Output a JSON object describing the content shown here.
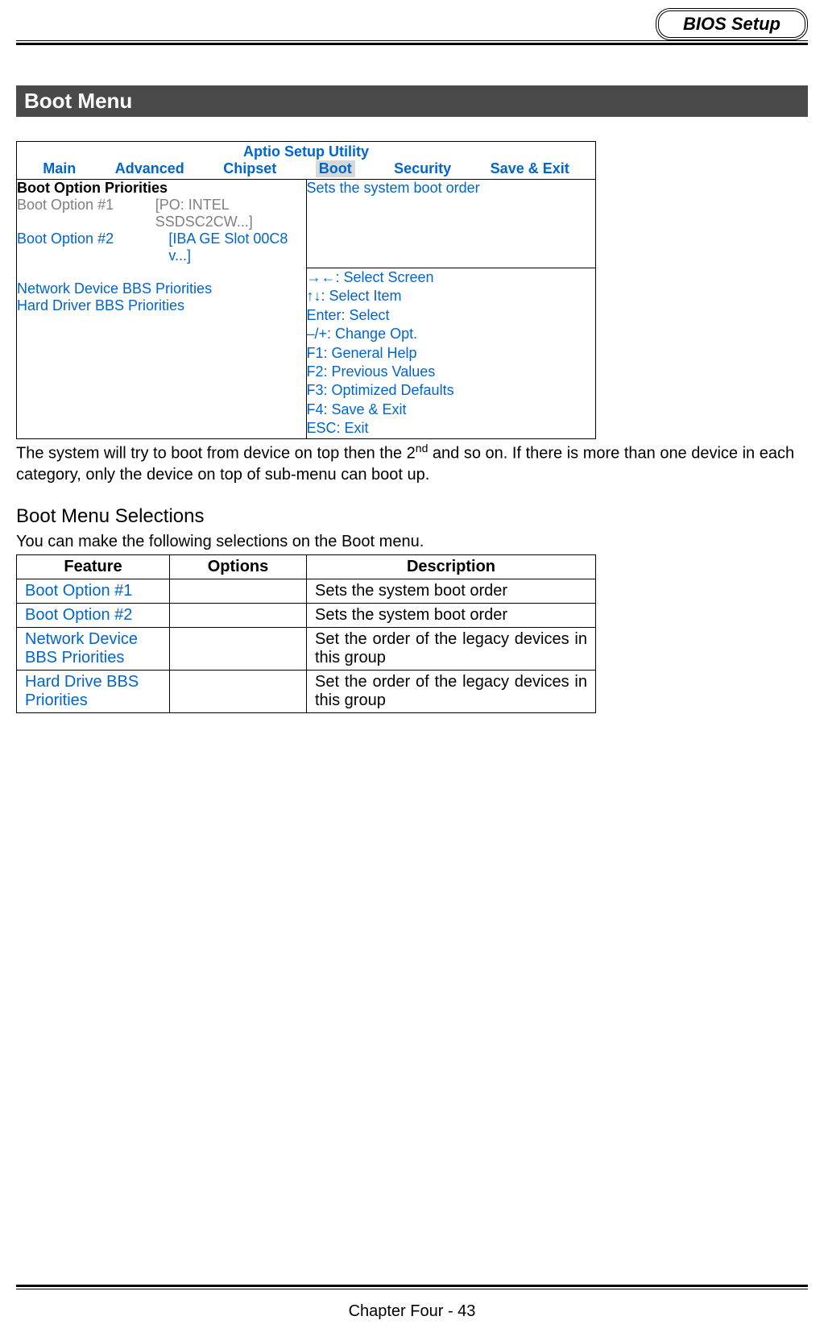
{
  "header": {
    "badge": "BIOS Setup"
  },
  "section_title": "Boot Menu",
  "bios": {
    "utility_title": "Aptio Setup Utility",
    "tabs": {
      "main": "Main",
      "advanced": "Advanced",
      "chipset": "Chipset",
      "boot": "Boot",
      "security": "Security",
      "save_exit": "Save & Exit"
    },
    "main_panel": {
      "priorities_heading": "Boot Option Priorities",
      "option1_label": "Boot Option #1",
      "option1_value": "[PO: INTEL SSDSC2CW...]",
      "option2_label": "Boot Option #2",
      "option2_value": "[IBA GE Slot 00C8 v...]",
      "network_bbs": "Network Device BBS Priorities",
      "hard_bbs": "Hard Driver BBS Priorities"
    },
    "right_panel": {
      "description": "Sets the system boot order",
      "help": {
        "select_screen": "→←: Select Screen",
        "select_item": "↑↓: Select Item",
        "enter": "Enter: Select",
        "change_opt": "–/+: Change Opt.",
        "f1": "F1: General Help",
        "f2": "F2: Previous Values",
        "f3": "F3: Optimized Defaults",
        "f4": "F4: Save & Exit",
        "esc": "ESC: Exit"
      }
    }
  },
  "paragraphs": {
    "boot_note_pre": "The system will try to boot from device on top then the 2",
    "boot_note_sup": "nd",
    "boot_note_post": " and so on. If there is more than one device in each category, only the device on top of sub-menu can boot up.",
    "selections_heading": "Boot Menu Selections",
    "selections_intro": "You can make the following selections on the Boot menu."
  },
  "selections_table": {
    "headers": {
      "feature": "Feature",
      "options": "Options",
      "description": "Description"
    },
    "rows": [
      {
        "feature": "Boot Option #1",
        "options": "",
        "description": "Sets the system boot order"
      },
      {
        "feature": "Boot Option #2",
        "options": "",
        "description": "Sets the system boot order"
      },
      {
        "feature": "Network Device BBS Priorities",
        "options": "",
        "description": "Set the order of the legacy devices in this group"
      },
      {
        "feature": "Hard Drive BBS Priorities",
        "options": "",
        "description": "Set the order of the legacy devices in this group"
      }
    ]
  },
  "footer": {
    "text": "Chapter Four - 43"
  }
}
